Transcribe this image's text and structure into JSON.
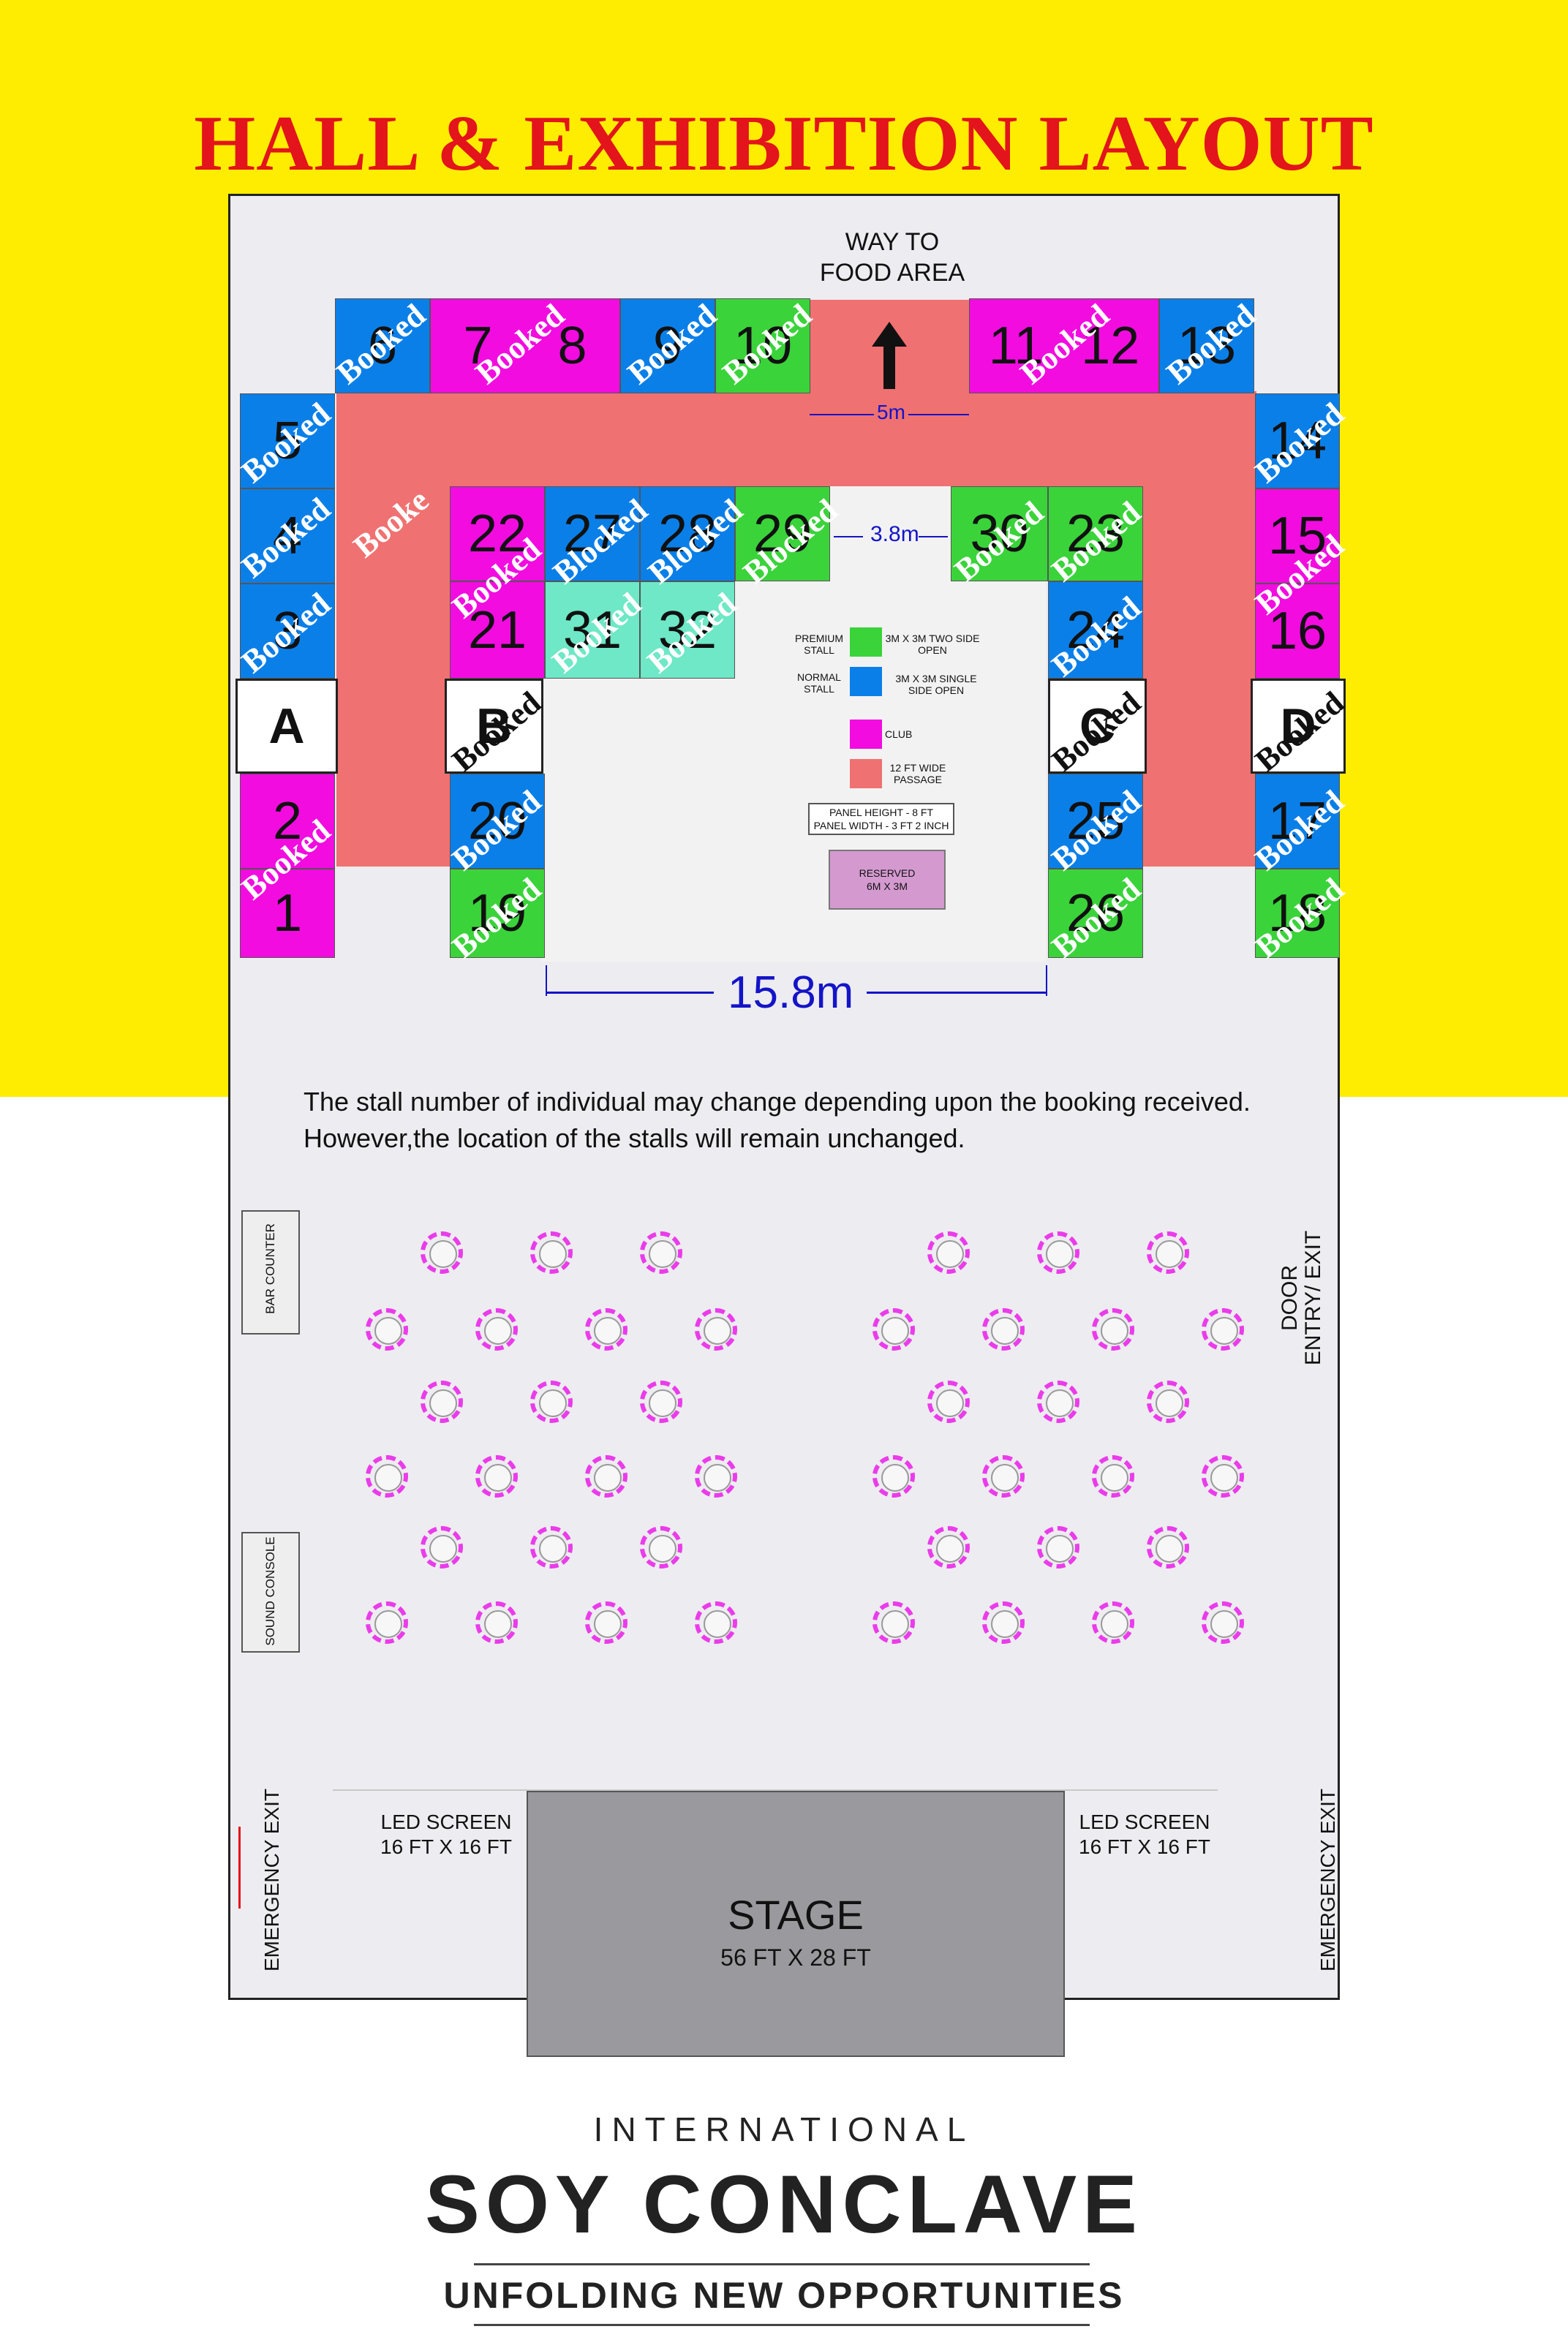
{
  "title": "HALL & EXHIBITION LAYOUT",
  "top": {
    "food_area_line1": "WAY TO",
    "food_area_line2": "FOOD AREA",
    "dim_5m": "5m",
    "dim_38m": "3.8m",
    "dim_158m": "15.8m"
  },
  "stalls": {
    "s1": "1",
    "s2": "2",
    "s3": "3",
    "s4": "4",
    "s5": "5",
    "s6": "6",
    "s7": "7",
    "s8": "8",
    "s9": "9",
    "s10": "10",
    "s11": "11",
    "s12": "12",
    "s13": "13",
    "s14": "14",
    "s15": "15",
    "s16": "16",
    "s17": "17",
    "s18": "18",
    "s19": "19",
    "s20": "20",
    "s21": "21",
    "s22": "22",
    "s23": "23",
    "s24": "24",
    "s25": "25",
    "s26": "26",
    "s27": "27",
    "s28": "28",
    "s29": "29",
    "s30": "30",
    "s31": "31",
    "s32": "32"
  },
  "blocks": {
    "a": "A",
    "b": "B",
    "c": "C",
    "d": "D"
  },
  "status": {
    "booked": "Booked",
    "blocked": "Blocked",
    "booked_partial": "Booke"
  },
  "legend": {
    "premium_label": "PREMIUM STALL",
    "premium_desc": "3M X 3M TWO SIDE OPEN",
    "normal_label": "NORMAL STALL",
    "normal_desc": "3M X 3M SINGLE SIDE OPEN",
    "club": "CLUB",
    "passage": "12 FT WIDE PASSAGE",
    "panel_height": "PANEL HEIGHT - 8 FT",
    "panel_width": "PANEL WIDTH - 3 FT 2 INCH",
    "reserved": "RESERVED",
    "reserved_size": "6M X 3M"
  },
  "note": {
    "line1": "The stall number of individual may change depending upon the booking received.",
    "line2": "However,the location of the stalls will remain unchanged."
  },
  "hall": {
    "bar_counter": "BAR COUNTER",
    "sound_console": "SOUND CONSOLE",
    "door_line1": "DOOR",
    "door_line2": "ENTRY/ EXIT",
    "emergency_exit": "EMERGENCY EXIT",
    "led_screen": "LED SCREEN",
    "led_size": "16 FT X 16 FT",
    "stage": "STAGE",
    "stage_size": "56 FT X 28 FT"
  },
  "logo": {
    "international": "INTERNATIONAL",
    "name": "SOY CONCLAVE",
    "tagline": "UNFOLDING NEW OPPORTUNITIES"
  },
  "colors": {
    "premium": "#3ad33a",
    "normal": "#0b7fe8",
    "club": "#f20ce0",
    "passage": "#f07171",
    "reserved": "#d49ad0",
    "title": "#e3141b",
    "background": "#ffed00"
  }
}
